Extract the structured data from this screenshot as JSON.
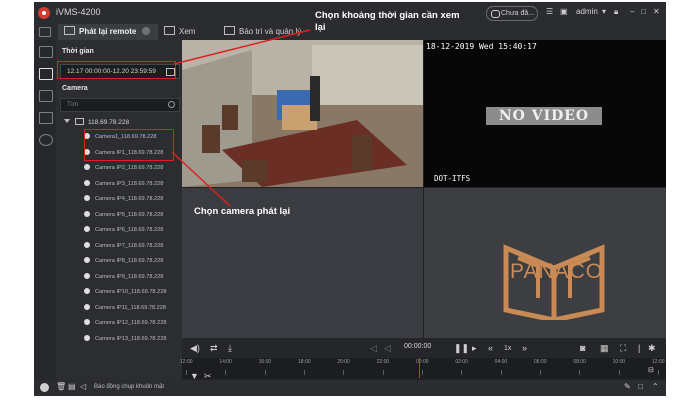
{
  "app": {
    "title": "iVMS-4200"
  },
  "tabs": [
    {
      "label": "Phát lại remote",
      "active": true
    },
    {
      "label": "Xem",
      "active": false
    },
    {
      "label": "Bảo trì và quản lý",
      "active": false
    }
  ],
  "titlebar": {
    "status": "Chưa đă...",
    "user": "admin"
  },
  "sidebar": {
    "time_label": "Thời gian",
    "date_range": "12.17 00:00:00-12.20 23:59:59",
    "camera_label": "Camera",
    "search_placeholder": "Tìm",
    "root": "118.69.78.228",
    "cameras": [
      "Camera1_118.69.78.228",
      "Camera IP1_118.69.78.228",
      "Camera IP2_118.69.78.228",
      "Camera IP3_118.69.78.228",
      "Camera IP4_118.69.78.228",
      "Camera IP5_118.69.78.228",
      "Camera IP6_118.69.78.228",
      "Camera IP7_118.69.78.228",
      "Camera IP8_118.69.78.228",
      "Camera IP9_118.69.78.228",
      "Camera IP10_118.69.78.228",
      "Camera IP11_118.69.78.228",
      "Camera IP12_118.69.78.228",
      "Camera IP13_118.69.78.228"
    ]
  },
  "video": {
    "osd_time": "18-12-2019 Wed 15:40:17",
    "no_video": "NO VIDEO",
    "cam_name": "DOT-ITFS",
    "watermark": "PANACO"
  },
  "controls": {
    "time": "00:00:00",
    "speed": "1x"
  },
  "timeline": {
    "ticks": [
      "12:00",
      "14:00",
      "16:00",
      "18:00",
      "20:00",
      "22:00",
      "00:00",
      "02:00",
      "04:00",
      "06:00",
      "08:00",
      "10:00",
      "12:00"
    ]
  },
  "statusbar": {
    "text": "Báo động chụp khuôn mặt"
  },
  "annotations": {
    "time_hint": "Chọn khoảng thời gian cần xem lại",
    "camera_hint": "Chọn camera phát lại"
  },
  "colors": {
    "annotation": "#e02020",
    "brand": "#c98a55"
  }
}
